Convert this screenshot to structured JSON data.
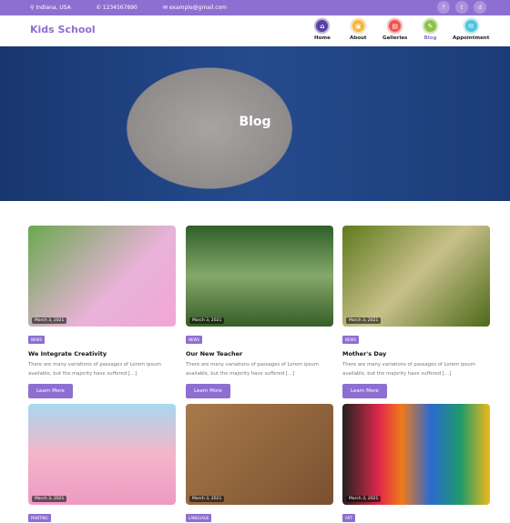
{
  "topbar": {
    "location": "Indiana, USA",
    "phone": "1234567890",
    "email": "example@gmail.com",
    "social": [
      "f",
      "t",
      "d"
    ]
  },
  "header": {
    "logo": "Kids School",
    "nav": [
      {
        "label": "Home",
        "icon": "home-icon",
        "color": "#5a3fa6"
      },
      {
        "label": "About",
        "icon": "about-icon",
        "color": "#f5b63c"
      },
      {
        "label": "Galleries",
        "icon": "gallery-icon",
        "color": "#ef5350"
      },
      {
        "label": "Blog",
        "icon": "blog-icon",
        "color": "#8bc34a",
        "active": true
      },
      {
        "label": "Appointment",
        "icon": "appointment-icon",
        "color": "#4fc3dc"
      }
    ]
  },
  "hero": {
    "title": "Blog"
  },
  "posts": [
    {
      "date": "March 3, 2021",
      "tag": "NEWS",
      "title": "We Integrate Creativity",
      "excerpt": "There are many variations of passages of Lorem ipsum available, but the majority have suffered [...]",
      "button": "Learn More"
    },
    {
      "date": "March 3, 2021",
      "tag": "NEWS",
      "title": "Our New Teacher",
      "excerpt": "There are many variations of passages of Lorem ipsum available, but the majority have suffered [...]",
      "button": "Learn More"
    },
    {
      "date": "March 3, 2021",
      "tag": "NEWS",
      "title": "Mother's Day",
      "excerpt": "There are many variations of passages of Lorem ipsum available, but the majority have suffered [...]",
      "button": "Learn More"
    },
    {
      "date": "March 3, 2021",
      "tag": "PAINTING"
    },
    {
      "date": "March 3, 2021",
      "tag": "LANGUAGE"
    },
    {
      "date": "March 3, 2021",
      "tag": "ART"
    }
  ],
  "colors": {
    "accent": "#8d6fd1",
    "blog_active": "#8d6fd1"
  }
}
